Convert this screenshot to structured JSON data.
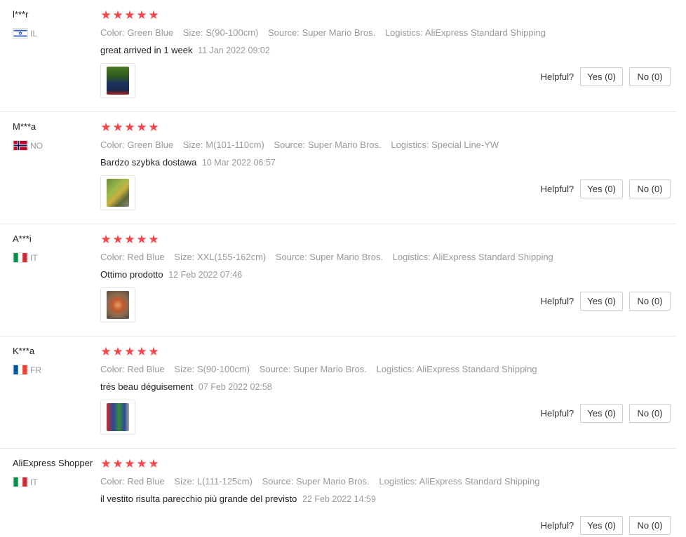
{
  "labels": {
    "color": "Color:",
    "size": "Size:",
    "source": "Source:",
    "logistics": "Logistics:",
    "helpful": "Helpful?"
  },
  "colors": {
    "star": "#f5444b",
    "muted": "#999999",
    "border": "#e8e8e8"
  },
  "reviews": [
    {
      "user": "l***r",
      "country": "IL",
      "flag_icon": "israel-flag-icon",
      "rating": 5,
      "color": "Green Blue",
      "size": "S(90-100cm)",
      "source": "Super Mario Bros.",
      "logistics": "AliExpress Standard Shipping",
      "text": "great arrived in 1 week",
      "date": "11 Jan 2022 09:02",
      "yes": "Yes (0)",
      "no": "No (0)"
    },
    {
      "user": "M***a",
      "country": "NO",
      "flag_icon": "norway-flag-icon",
      "rating": 5,
      "color": "Green Blue",
      "size": "M(101-110cm)",
      "source": "Super Mario Bros.",
      "logistics": "Special Line-YW",
      "text": "Bardzo szybka dostawa",
      "date": "10 Mar 2022 06:57",
      "yes": "Yes (0)",
      "no": "No (0)"
    },
    {
      "user": "A***i",
      "country": "IT",
      "flag_icon": "italy-flag-icon",
      "rating": 5,
      "color": "Red Blue",
      "size": "XXL(155-162cm)",
      "source": "Super Mario Bros.",
      "logistics": "AliExpress Standard Shipping",
      "text": "Ottimo prodotto",
      "date": "12 Feb 2022 07:46",
      "yes": "Yes (0)",
      "no": "No (0)"
    },
    {
      "user": "K***a",
      "country": "FR",
      "flag_icon": "france-flag-icon",
      "rating": 5,
      "color": "Red Blue",
      "size": "S(90-100cm)",
      "source": "Super Mario Bros.",
      "logistics": "AliExpress Standard Shipping",
      "text": "très beau déguisement",
      "date": "07 Feb 2022 02:58",
      "yes": "Yes (0)",
      "no": "No (0)"
    },
    {
      "user": "AliExpress Shopper",
      "country": "IT",
      "flag_icon": "italy-flag-icon",
      "rating": 5,
      "color": "Red Blue",
      "size": "L(111-125cm)",
      "source": "Super Mario Bros.",
      "logistics": "AliExpress Standard Shipping",
      "text": "il vestito risulta parecchio più grande del previsto",
      "date": "22 Feb 2022 14:59",
      "yes": "Yes (0)",
      "no": "No (0)"
    }
  ]
}
